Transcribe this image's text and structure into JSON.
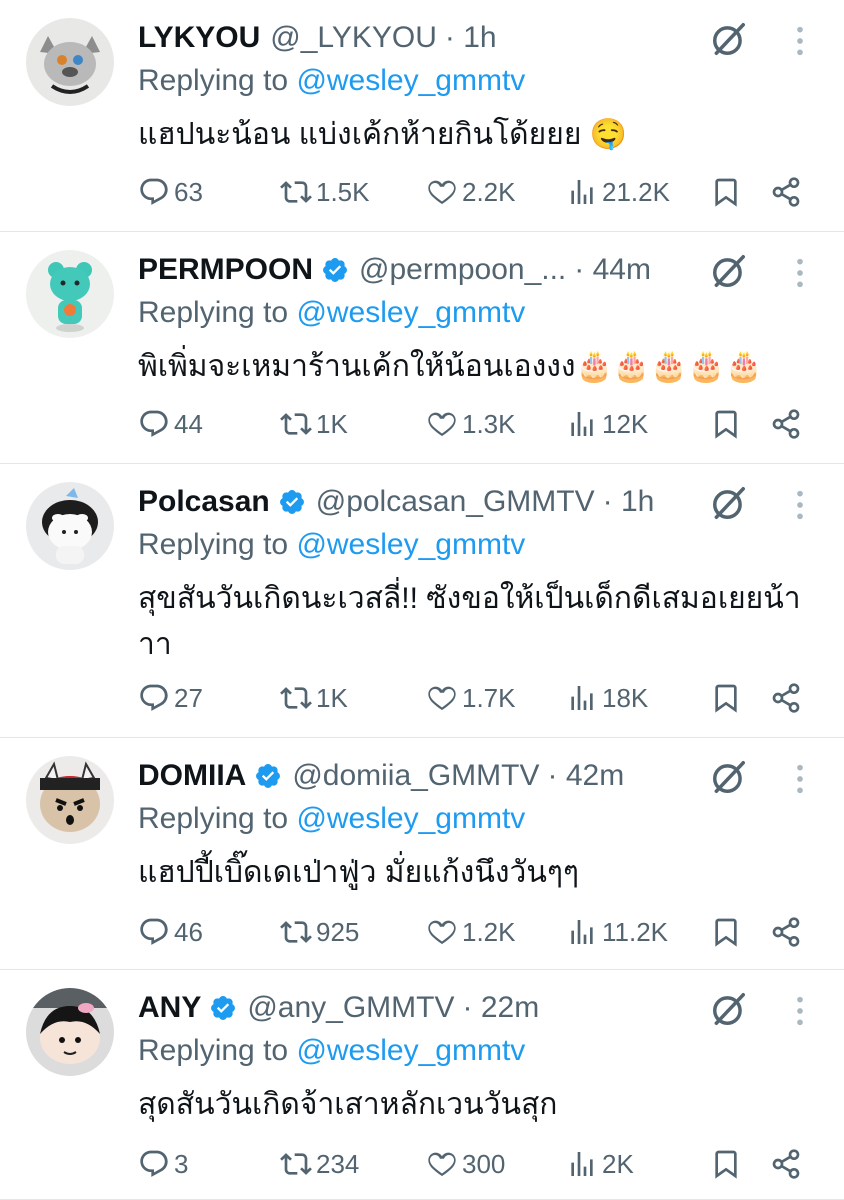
{
  "reply_prefix": "Replying to",
  "tweets": [
    {
      "name": "LYKYOU",
      "handle": "@_LYKYOU",
      "time": "· 1h",
      "verified": false,
      "reply_to": "@wesley_gmmtv",
      "text": "แฮปนะน้อน แบ่งเค้กห้ายกินโด้ยยย 🤤",
      "replies": "63",
      "retweets": "1.5K",
      "likes": "2.2K",
      "views": "21.2K",
      "avatar": "gray-wolf-plush-avatar"
    },
    {
      "name": "PERMPOON",
      "handle": "@permpoon_...",
      "time": "· 44m",
      "verified": true,
      "reply_to": "@wesley_gmmtv",
      "text": "พิเพิ่มจะเหมาร้านเค้กให้น้อนเองงง🎂🎂🎂🎂🎂",
      "replies": "44",
      "retweets": "1K",
      "likes": "1.3K",
      "views": "12K",
      "avatar": "teal-bear-figure-avatar"
    },
    {
      "name": "Polcasan",
      "handle": "@polcasan_GMMTV",
      "time": "· 1h",
      "verified": true,
      "reply_to": "@wesley_gmmtv",
      "text": "สุขสันวันเกิดนะเวสลี่!! ซังขอให้เป็นเด็กดีเสมอเยยน้าาา",
      "replies": "27",
      "retweets": "1K",
      "likes": "1.7K",
      "views": "18K",
      "avatar": "orca-plush-avatar"
    },
    {
      "name": "DOMIIA",
      "handle": "@domiia_GMMTV",
      "time": "· 42m",
      "verified": true,
      "reply_to": "@wesley_gmmtv",
      "text": "แฮปปี้เบิ๊ดเดเป่าฟู่ว มั่ยแก้งนึงวันๆๆ",
      "replies": "46",
      "retweets": "925",
      "likes": "1.2K",
      "views": "11.2K",
      "avatar": "horned-face-plush-avatar"
    },
    {
      "name": "ANY",
      "handle": "@any_GMMTV",
      "time": "· 22m",
      "verified": true,
      "reply_to": "@wesley_gmmtv",
      "text": "สุดสันวันเกิดจ้าเสาหลักเวนวันสุก",
      "replies": "3",
      "retweets": "234",
      "likes": "300",
      "views": "2K",
      "avatar": "black-hair-plush-avatar"
    }
  ],
  "colors": {
    "text": "#0f1419",
    "secondary": "#536471",
    "mention": "#1d9bf0",
    "verified": "#1d9bf0",
    "divider": "#e1e8ed"
  }
}
